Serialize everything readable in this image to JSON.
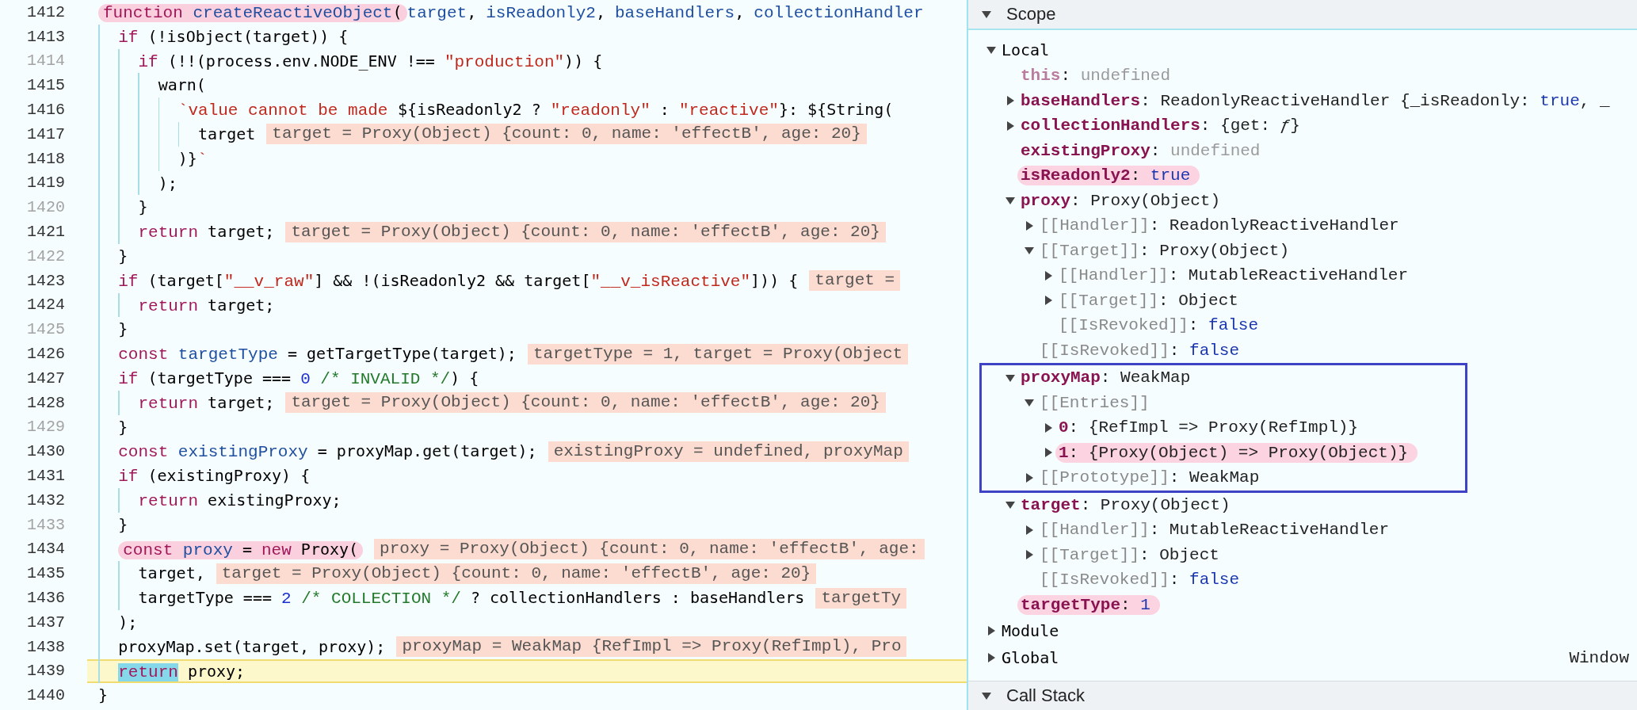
{
  "editor": {
    "lines": [
      {
        "number": "1412",
        "breakable": true,
        "current": false,
        "marked": true,
        "tokens": [
          {
            "kind": "kw",
            "text": "function"
          },
          {
            "kind": "def",
            "text": " createReactiveObject"
          },
          {
            "kind": "plain",
            "text": "("
          }
        ],
        "after": [
          {
            "kind": "def",
            "text": "target"
          },
          {
            "kind": "plain",
            "text": ", "
          },
          {
            "kind": "def",
            "text": "isReadonly2"
          },
          {
            "kind": "plain",
            "text": ", "
          },
          {
            "kind": "def",
            "text": "baseHandlers"
          },
          {
            "kind": "plain",
            "text": ", "
          },
          {
            "kind": "def",
            "text": "collectionHandler"
          }
        ]
      },
      {
        "number": "1413",
        "breakable": true,
        "current": false,
        "marked": false,
        "tokens": [
          {
            "kind": "kw",
            "text": "  if"
          },
          {
            "kind": "plain",
            "text": " (!isObject(target)) {"
          }
        ]
      },
      {
        "number": "1414",
        "breakable": false,
        "current": false,
        "marked": false,
        "tokens": [
          {
            "kind": "kw",
            "text": "    if"
          },
          {
            "kind": "plain",
            "text": " (!!(process.env.NODE_ENV !== "
          },
          {
            "kind": "str",
            "text": "\"production\""
          },
          {
            "kind": "plain",
            "text": ")) {"
          }
        ]
      },
      {
        "number": "1415",
        "breakable": true,
        "current": false,
        "marked": false,
        "tokens": [
          {
            "kind": "plain",
            "text": "      warn("
          }
        ]
      },
      {
        "number": "1416",
        "breakable": true,
        "current": false,
        "marked": false,
        "tokens": [
          {
            "kind": "str",
            "text": "        `value cannot be made "
          },
          {
            "kind": "plain",
            "text": "${isReadonly2 ? "
          },
          {
            "kind": "str",
            "text": "\"readonly\""
          },
          {
            "kind": "plain",
            "text": " : "
          },
          {
            "kind": "str",
            "text": "\"reactive\""
          },
          {
            "kind": "plain",
            "text": "}: ${String("
          }
        ]
      },
      {
        "number": "1417",
        "breakable": true,
        "current": false,
        "marked": false,
        "tokens": [
          {
            "kind": "plain",
            "text": "          target"
          }
        ],
        "value": "target = Proxy(Object) {count: 0, name: 'effectB', age: 20}"
      },
      {
        "number": "1418",
        "breakable": true,
        "current": false,
        "marked": false,
        "tokens": [
          {
            "kind": "plain",
            "text": "        )}"
          },
          {
            "kind": "str",
            "text": "`"
          }
        ]
      },
      {
        "number": "1419",
        "breakable": true,
        "current": false,
        "marked": false,
        "tokens": [
          {
            "kind": "plain",
            "text": "      );"
          }
        ]
      },
      {
        "number": "1420",
        "breakable": false,
        "current": false,
        "marked": false,
        "tokens": [
          {
            "kind": "plain",
            "text": "    }"
          }
        ]
      },
      {
        "number": "1421",
        "breakable": true,
        "current": false,
        "marked": false,
        "tokens": [
          {
            "kind": "kw",
            "text": "    return"
          },
          {
            "kind": "plain",
            "text": " target;"
          }
        ],
        "value": "target = Proxy(Object) {count: 0, name: 'effectB', age: 20}"
      },
      {
        "number": "1422",
        "breakable": false,
        "current": false,
        "marked": false,
        "tokens": [
          {
            "kind": "plain",
            "text": "  }"
          }
        ]
      },
      {
        "number": "1423",
        "breakable": true,
        "current": false,
        "marked": false,
        "tokens": [
          {
            "kind": "kw",
            "text": "  if"
          },
          {
            "kind": "plain",
            "text": " (target["
          },
          {
            "kind": "str",
            "text": "\"__v_raw\""
          },
          {
            "kind": "plain",
            "text": "] && !(isReadonly2 && target["
          },
          {
            "kind": "str",
            "text": "\"__v_isReactive\""
          },
          {
            "kind": "plain",
            "text": "])) {"
          }
        ],
        "value": "target ="
      },
      {
        "number": "1424",
        "breakable": true,
        "current": false,
        "marked": false,
        "tokens": [
          {
            "kind": "kw",
            "text": "    return"
          },
          {
            "kind": "plain",
            "text": " target;"
          }
        ]
      },
      {
        "number": "1425",
        "breakable": false,
        "current": false,
        "marked": false,
        "tokens": [
          {
            "kind": "plain",
            "text": "  }"
          }
        ]
      },
      {
        "number": "1426",
        "breakable": true,
        "current": false,
        "marked": false,
        "tokens": [
          {
            "kind": "kw",
            "text": "  const"
          },
          {
            "kind": "def",
            "text": " targetType"
          },
          {
            "kind": "plain",
            "text": " = getTargetType(target);"
          }
        ],
        "value": "targetType = 1, target = Proxy(Object"
      },
      {
        "number": "1427",
        "breakable": true,
        "current": false,
        "marked": false,
        "tokens": [
          {
            "kind": "kw",
            "text": "  if"
          },
          {
            "kind": "plain",
            "text": " (targetType === "
          },
          {
            "kind": "num",
            "text": "0"
          },
          {
            "kind": "comment",
            "text": " /* INVALID */"
          },
          {
            "kind": "plain",
            "text": ") {"
          }
        ]
      },
      {
        "number": "1428",
        "breakable": true,
        "current": false,
        "marked": false,
        "tokens": [
          {
            "kind": "kw",
            "text": "    return"
          },
          {
            "kind": "plain",
            "text": " target;"
          }
        ],
        "value": "target = Proxy(Object) {count: 0, name: 'effectB', age: 20}"
      },
      {
        "number": "1429",
        "breakable": false,
        "current": false,
        "marked": false,
        "tokens": [
          {
            "kind": "plain",
            "text": "  }"
          }
        ]
      },
      {
        "number": "1430",
        "breakable": true,
        "current": false,
        "marked": false,
        "tokens": [
          {
            "kind": "kw",
            "text": "  const"
          },
          {
            "kind": "def",
            "text": " existingProxy"
          },
          {
            "kind": "plain",
            "text": " = proxyMap.get(target);"
          }
        ],
        "value": "existingProxy = undefined, proxyMap"
      },
      {
        "number": "1431",
        "breakable": true,
        "current": false,
        "marked": false,
        "tokens": [
          {
            "kind": "kw",
            "text": "  if"
          },
          {
            "kind": "plain",
            "text": " (existingProxy) {"
          }
        ]
      },
      {
        "number": "1432",
        "breakable": true,
        "current": false,
        "marked": false,
        "tokens": [
          {
            "kind": "kw",
            "text": "    return"
          },
          {
            "kind": "plain",
            "text": " existingProxy;"
          }
        ]
      },
      {
        "number": "1433",
        "breakable": false,
        "current": false,
        "marked": false,
        "tokens": [
          {
            "kind": "plain",
            "text": "  }"
          }
        ]
      },
      {
        "number": "1434",
        "breakable": true,
        "current": false,
        "marked": true,
        "tokens": [
          {
            "kind": "kw",
            "text": "  const"
          },
          {
            "kind": "def",
            "text": " proxy"
          },
          {
            "kind": "plain",
            "text": " = "
          },
          {
            "kind": "kw",
            "text": "new"
          },
          {
            "kind": "plain",
            "text": " Proxy("
          }
        ],
        "value": "proxy = Proxy(Object) {count: 0, name: 'effectB', age:"
      },
      {
        "number": "1435",
        "breakable": true,
        "current": false,
        "marked": false,
        "tokens": [
          {
            "kind": "plain",
            "text": "    target,"
          }
        ],
        "value": "target = Proxy(Object) {count: 0, name: 'effectB', age: 20}"
      },
      {
        "number": "1436",
        "breakable": true,
        "current": false,
        "marked": false,
        "tokens": [
          {
            "kind": "plain",
            "text": "    targetType === "
          },
          {
            "kind": "num",
            "text": "2"
          },
          {
            "kind": "comment",
            "text": " /* COLLECTION */"
          },
          {
            "kind": "plain",
            "text": " ? collectionHandlers : baseHandlers"
          }
        ],
        "value": "targetTy"
      },
      {
        "number": "1437",
        "breakable": true,
        "current": false,
        "marked": false,
        "tokens": [
          {
            "kind": "plain",
            "text": "  );"
          }
        ]
      },
      {
        "number": "1438",
        "breakable": true,
        "current": false,
        "marked": false,
        "tokens": [
          {
            "kind": "plain",
            "text": "  proxyMap.set(target, proxy);"
          }
        ],
        "value": "proxyMap = WeakMap {RefImpl => Proxy(RefImpl), Pro"
      },
      {
        "number": "1439",
        "breakable": true,
        "current": true,
        "marked": false,
        "tokens": [
          {
            "kind": "exec",
            "text": "  return"
          },
          {
            "kind": "plain",
            "text": " proxy;"
          }
        ]
      },
      {
        "number": "1440",
        "breakable": true,
        "current": false,
        "marked": false,
        "tokens": [
          {
            "kind": "plain",
            "text": "}"
          }
        ]
      }
    ]
  },
  "scope_pane": {
    "title": "Scope",
    "expanded": true,
    "tree": [
      {
        "text": [
          {
            "kind": "plain",
            "text": "Local"
          }
        ],
        "expanded": true,
        "marked": false,
        "children": [
          {
            "text": [
              {
                "kind": "own-dim",
                "text": "this"
              },
              {
                "kind": "obj",
                "text": ": "
              },
              {
                "kind": "undef",
                "text": "undefined"
              }
            ],
            "marked": false
          },
          {
            "text": [
              {
                "kind": "own",
                "text": "baseHandlers"
              },
              {
                "kind": "obj",
                "text": ": ReadonlyReactiveHandler {_isReadonly: "
              },
              {
                "kind": "prim",
                "text": "true"
              },
              {
                "kind": "obj",
                "text": ", _"
              }
            ],
            "expanded": false,
            "marked": false
          },
          {
            "text": [
              {
                "kind": "own",
                "text": "collectionHandlers"
              },
              {
                "kind": "obj",
                "text": ": {get: "
              },
              {
                "kind": "fn",
                "text": "ƒ"
              },
              {
                "kind": "obj",
                "text": "}"
              }
            ],
            "expanded": false,
            "marked": false
          },
          {
            "text": [
              {
                "kind": "own",
                "text": "existingProxy"
              },
              {
                "kind": "obj",
                "text": ": "
              },
              {
                "kind": "undef",
                "text": "undefined"
              }
            ],
            "marked": false
          },
          {
            "text": [
              {
                "kind": "own",
                "text": "isReadonly2"
              },
              {
                "kind": "obj",
                "text": ": "
              },
              {
                "kind": "prim",
                "text": "true"
              }
            ],
            "marked": true
          },
          {
            "text": [
              {
                "kind": "own",
                "text": "proxy"
              },
              {
                "kind": "obj",
                "text": ": Proxy(Object)"
              }
            ],
            "expanded": true,
            "marked": false,
            "children": [
              {
                "text": [
                  {
                    "kind": "internal",
                    "text": "[[Handler]]"
                  },
                  {
                    "kind": "obj",
                    "text": ": ReadonlyReactiveHandler"
                  }
                ],
                "expanded": false,
                "marked": false
              },
              {
                "text": [
                  {
                    "kind": "internal",
                    "text": "[[Target]]"
                  },
                  {
                    "kind": "obj",
                    "text": ": Proxy(Object)"
                  }
                ],
                "expanded": true,
                "marked": false,
                "children": [
                  {
                    "text": [
                      {
                        "kind": "internal",
                        "text": "[[Handler]]"
                      },
                      {
                        "kind": "obj",
                        "text": ": MutableReactiveHandler"
                      }
                    ],
                    "expanded": false,
                    "marked": false
                  },
                  {
                    "text": [
                      {
                        "kind": "internal",
                        "text": "[[Target]]"
                      },
                      {
                        "kind": "obj",
                        "text": ": Object"
                      }
                    ],
                    "expanded": false,
                    "marked": false
                  },
                  {
                    "text": [
                      {
                        "kind": "internal",
                        "text": "[[IsRevoked]]"
                      },
                      {
                        "kind": "obj",
                        "text": ": "
                      },
                      {
                        "kind": "prim",
                        "text": "false"
                      }
                    ],
                    "marked": false
                  }
                ]
              },
              {
                "text": [
                  {
                    "kind": "internal",
                    "text": "[[IsRevoked]]"
                  },
                  {
                    "kind": "obj",
                    "text": ": "
                  },
                  {
                    "kind": "prim",
                    "text": "false"
                  }
                ],
                "marked": false
              }
            ]
          },
          {
            "text": [
              {
                "kind": "own",
                "text": "proxyMap"
              },
              {
                "kind": "obj",
                "text": ": WeakMap"
              }
            ],
            "expanded": true,
            "marked": false,
            "boxed": true,
            "children": [
              {
                "text": [
                  {
                    "kind": "internal",
                    "text": "[[Entries]]"
                  }
                ],
                "expanded": true,
                "marked": false,
                "children": [
                  {
                    "text": [
                      {
                        "kind": "own",
                        "text": "0"
                      },
                      {
                        "kind": "obj",
                        "text": ": {RefImpl => Proxy(RefImpl)}"
                      }
                    ],
                    "expanded": false,
                    "marked": false
                  },
                  {
                    "text": [
                      {
                        "kind": "own",
                        "text": "1"
                      },
                      {
                        "kind": "obj",
                        "text": ": {Proxy(Object) => Proxy(Object)}"
                      }
                    ],
                    "expanded": false,
                    "marked": true
                  }
                ]
              },
              {
                "text": [
                  {
                    "kind": "internal",
                    "text": "[[Prototype]]"
                  },
                  {
                    "kind": "obj",
                    "text": ": WeakMap"
                  }
                ],
                "expanded": false,
                "marked": false
              }
            ]
          },
          {
            "text": [
              {
                "kind": "own",
                "text": "target"
              },
              {
                "kind": "obj",
                "text": ": Proxy(Object)"
              }
            ],
            "expanded": true,
            "marked": false,
            "children": [
              {
                "text": [
                  {
                    "kind": "internal",
                    "text": "[[Handler]]"
                  },
                  {
                    "kind": "obj",
                    "text": ": MutableReactiveHandler"
                  }
                ],
                "expanded": false,
                "marked": false
              },
              {
                "text": [
                  {
                    "kind": "internal",
                    "text": "[[Target]]"
                  },
                  {
                    "kind": "obj",
                    "text": ": Object"
                  }
                ],
                "expanded": false,
                "marked": false
              },
              {
                "text": [
                  {
                    "kind": "internal",
                    "text": "[[IsRevoked]]"
                  },
                  {
                    "kind": "obj",
                    "text": ": "
                  },
                  {
                    "kind": "prim",
                    "text": "false"
                  }
                ],
                "marked": false
              }
            ]
          },
          {
            "text": [
              {
                "kind": "own",
                "text": "targetType"
              },
              {
                "kind": "obj",
                "text": ": "
              },
              {
                "kind": "prim",
                "text": "1"
              }
            ],
            "marked": true
          }
        ]
      },
      {
        "text": [
          {
            "kind": "plain",
            "text": "Module"
          }
        ],
        "expanded": false,
        "marked": false
      },
      {
        "text": [
          {
            "kind": "plain",
            "text": "Global"
          }
        ],
        "expanded": false,
        "marked": false,
        "aside": "Window"
      }
    ]
  },
  "call_stack_pane": {
    "title": "Call Stack",
    "expanded": true
  }
}
